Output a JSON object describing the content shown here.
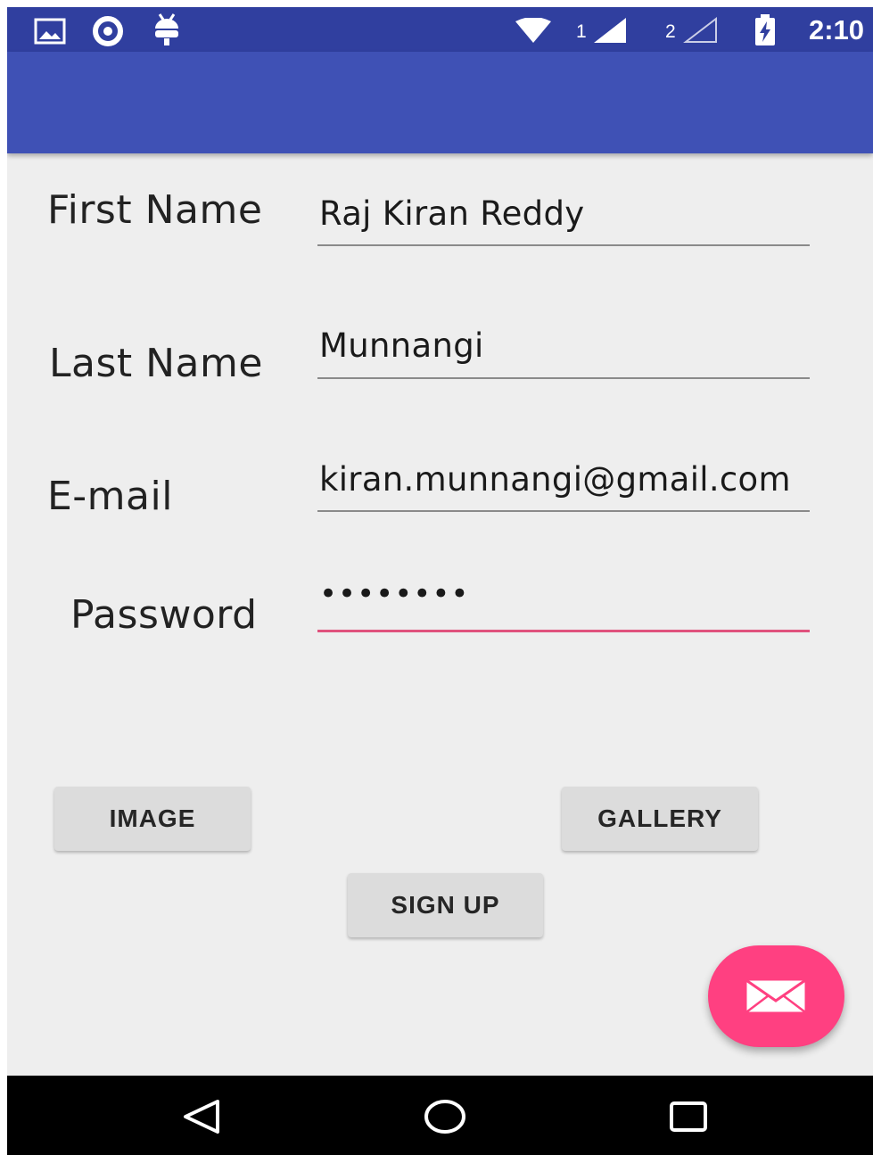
{
  "status_bar": {
    "time": "2:10",
    "sim1": "1",
    "sim2": "2",
    "left_icons": [
      "gallery-notification-icon",
      "app-notification-icon",
      "android-debug-icon"
    ],
    "right_icons": [
      "wifi-icon",
      "signal-sim1-icon",
      "signal-sim2-icon",
      "battery-charging-icon"
    ]
  },
  "colors": {
    "status_bar": "#303f9f",
    "app_bar": "#3f51b5",
    "accent": "#ff4081",
    "background": "#eeeeee"
  },
  "form": {
    "first_name": {
      "label": "First Name",
      "value": "Raj Kiran Reddy"
    },
    "last_name": {
      "label": "Last Name",
      "value": "Munnangi"
    },
    "email": {
      "label": "E-mail",
      "value": "kiran.munnangi@gmail.com"
    },
    "password": {
      "label": "Password",
      "value": "••••••••"
    }
  },
  "buttons": {
    "image": "IMAGE",
    "gallery": "GALLERY",
    "sign_up": "SIGN UP"
  },
  "fab": {
    "icon": "mail-icon"
  },
  "nav": {
    "icons": [
      "back-icon",
      "home-icon",
      "recents-icon"
    ]
  }
}
